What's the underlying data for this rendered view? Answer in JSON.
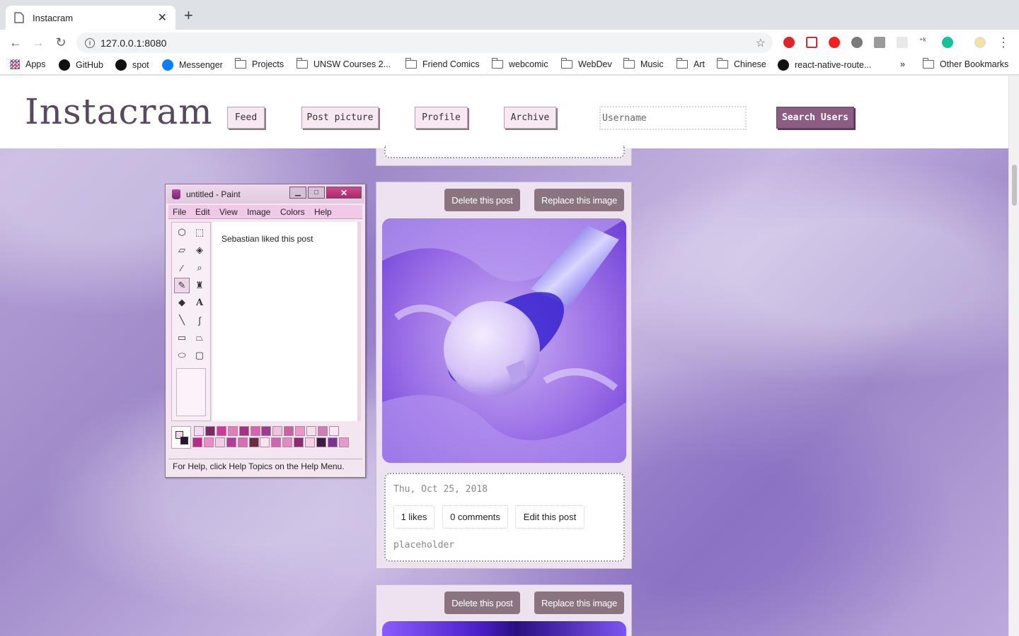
{
  "browser": {
    "tab_title": "Instacram",
    "url": "127.0.0.1:8080",
    "bookmarks": [
      "Apps",
      "GitHub",
      "spot",
      "Messenger",
      "Projects",
      "UNSW Courses 2...",
      "Friend Comics",
      "webcomic",
      "WebDev",
      "Music",
      "Art",
      "Chinese",
      "react-native-route...",
      "Other Bookmarks"
    ],
    "overflow": "»"
  },
  "header": {
    "logo": "Instacram",
    "nav": [
      "Feed",
      "Post picture",
      "Profile",
      "Archive"
    ],
    "search_placeholder": "Username",
    "search_button": "Search Users"
  },
  "post": {
    "delete_label": "Delete this post",
    "replace_label": "Replace this image",
    "date": "Thu, Oct 25, 2018",
    "likes": "1 likes",
    "comments": "0 comments",
    "edit_label": "Edit this post",
    "caption": "placeholder"
  },
  "post2": {
    "delete_label": "Delete this post",
    "replace_label": "Replace this image"
  },
  "paint": {
    "title": "untitled - Paint",
    "menu": [
      "File",
      "Edit",
      "View",
      "Image",
      "Colors",
      "Help"
    ],
    "canvas_text": "Sebastian liked this post",
    "status": "For Help, click Help Topics on the Help Menu.",
    "palette_top": [
      "#f6d9ec",
      "#7c2a63",
      "#d2389a",
      "#e27fb8",
      "#a5327f",
      "#d765ad",
      "#9c3e8f",
      "#f2c1de",
      "#c9639f",
      "#ee96c6",
      "#f6dced",
      "#d07db3",
      "#fbe8f3"
    ],
    "palette_bottom": [
      "#bb2a86",
      "#ef8ac4",
      "#f4cce4",
      "#b43c96",
      "#d86eb0",
      "#6f2a42",
      "#fbe4f1",
      "#cd66ad",
      "#e18cbf",
      "#8c2b70",
      "#f6d0e8",
      "#3a1d43",
      "#7a3590",
      "#e59acb"
    ]
  },
  "colors": {
    "accent": "#8d5c83",
    "post_bg": "#ede2ef",
    "button_gray": "#8a7480"
  }
}
